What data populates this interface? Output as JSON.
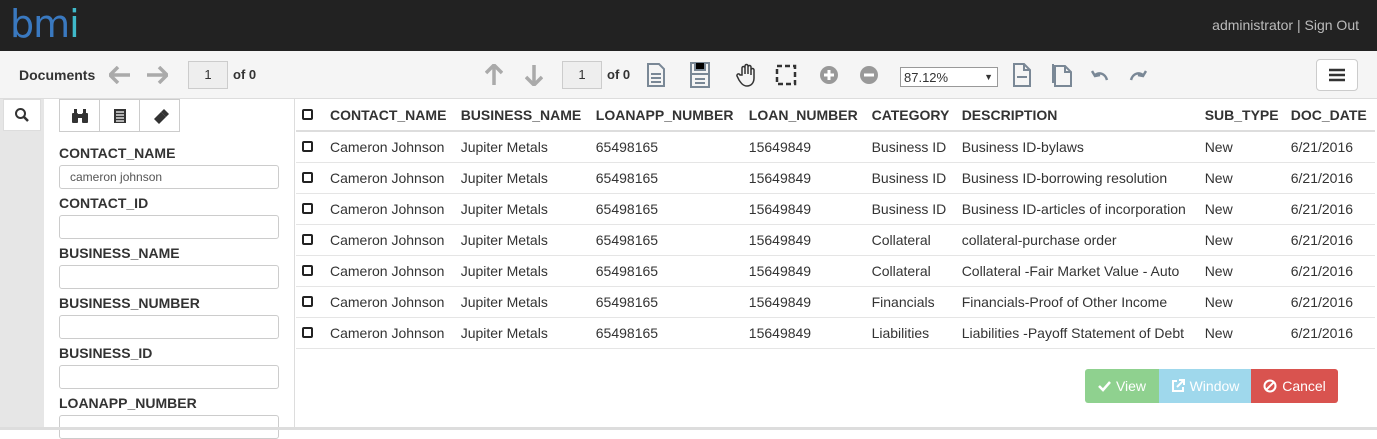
{
  "header": {
    "logo_text": "bm",
    "logo_i": "i",
    "user": "administrator",
    "separator": "|",
    "signout": "Sign Out"
  },
  "toolbar": {
    "documents_label": "Documents",
    "doc_page": "1",
    "doc_of": "of 0",
    "page": "1",
    "page_of": "of 0",
    "zoom": "87.12%"
  },
  "filter": {
    "fields": [
      {
        "label": "CONTACT_NAME",
        "value": "cameron johnson"
      },
      {
        "label": "CONTACT_ID",
        "value": ""
      },
      {
        "label": "BUSINESS_NAME",
        "value": ""
      },
      {
        "label": "BUSINESS_NUMBER",
        "value": ""
      },
      {
        "label": "BUSINESS_ID",
        "value": ""
      },
      {
        "label": "LOANAPP_NUMBER",
        "value": ""
      }
    ]
  },
  "table": {
    "columns": [
      "CONTACT_NAME",
      "BUSINESS_NAME",
      "LOANAPP_NUMBER",
      "LOAN_NUMBER",
      "CATEGORY",
      "DESCRIPTION",
      "SUB_TYPE",
      "DOC_DATE"
    ],
    "rows": [
      [
        "Cameron Johnson",
        "Jupiter Metals",
        "65498165",
        "15649849",
        "Business ID",
        "Business ID-bylaws",
        "New",
        "6/21/2016"
      ],
      [
        "Cameron Johnson",
        "Jupiter Metals",
        "65498165",
        "15649849",
        "Business ID",
        "Business ID-borrowing resolution",
        "New",
        "6/21/2016"
      ],
      [
        "Cameron Johnson",
        "Jupiter Metals",
        "65498165",
        "15649849",
        "Business ID",
        "Business ID-articles of incorporation",
        "New",
        "6/21/2016"
      ],
      [
        "Cameron Johnson",
        "Jupiter Metals",
        "65498165",
        "15649849",
        "Collateral",
        "collateral-purchase order",
        "New",
        "6/21/2016"
      ],
      [
        "Cameron Johnson",
        "Jupiter Metals",
        "65498165",
        "15649849",
        "Collateral",
        "Collateral -Fair Market Value - Auto",
        "New",
        "6/21/2016"
      ],
      [
        "Cameron Johnson",
        "Jupiter Metals",
        "65498165",
        "15649849",
        "Financials",
        "Financials-Proof of Other Income",
        "New",
        "6/21/2016"
      ],
      [
        "Cameron Johnson",
        "Jupiter Metals",
        "65498165",
        "15649849",
        "Liabilities",
        "Liabilities -Payoff Statement of Debt",
        "New",
        "6/21/2016"
      ]
    ]
  },
  "actions": {
    "view": "View",
    "window": "Window",
    "cancel": "Cancel"
  },
  "colors": {
    "header_bg": "#222222",
    "view": "#8fd18f",
    "window": "#9fd8ec",
    "cancel": "#d9534f"
  }
}
